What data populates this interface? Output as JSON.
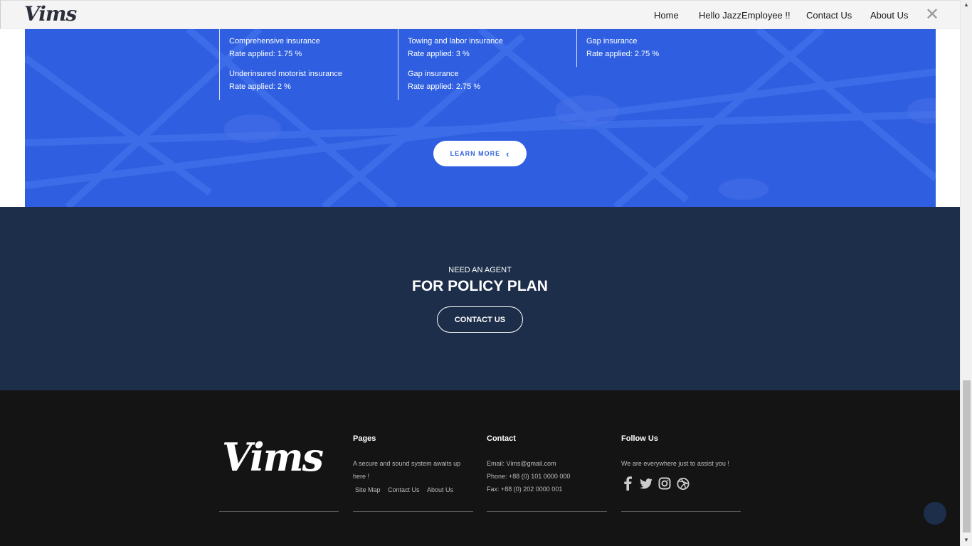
{
  "header": {
    "logo": "Vims",
    "nav": [
      "Home",
      "Hello JazzEmployee !!",
      "Contact Us",
      "About Us"
    ],
    "close_glyph": "✕"
  },
  "rates": {
    "columns": [
      [
        {
          "name": "Comprehensive insurance",
          "rate": "Rate applied: 1.75 %"
        },
        {
          "name": "Underinsured motorist insurance",
          "rate": "Rate applied: 2 %"
        }
      ],
      [
        {
          "name": "Towing and labor insurance",
          "rate": "Rate applied: 3 %"
        },
        {
          "name": "Gap insurance",
          "rate": "Rate applied: 2.75 %"
        }
      ],
      [
        {
          "name": "Gap insurance",
          "rate": "Rate applied: 2.75 %"
        }
      ]
    ],
    "learn_more": "LEARN MORE",
    "learn_more_icon": "chevron-left-icon",
    "accent": "#2f5fe0"
  },
  "agent": {
    "kicker": "NEED AN AGENT",
    "headline": "FOR POLICY PLAN",
    "button": "CONTACT US",
    "bg": "#1d2e4a"
  },
  "footer": {
    "logo": "Vims",
    "pages": {
      "title": "Pages",
      "text": "A secure and sound system awaits up here !",
      "links": [
        "Site Map",
        "Contact Us",
        "About Us"
      ]
    },
    "contact": {
      "title": "Contact",
      "email": "Email: Vims@gmail.com",
      "phone": "Phone: +88 (0) 101 0000 000",
      "fax": "Fax: +88 (0) 202 0000 001"
    },
    "follow": {
      "title": "Follow Us",
      "text": "We are everywhere just to assist you !",
      "icons": [
        "facebook-icon",
        "twitter-icon",
        "instagram-icon",
        "dribbble-icon"
      ]
    },
    "bg": "#141414"
  }
}
